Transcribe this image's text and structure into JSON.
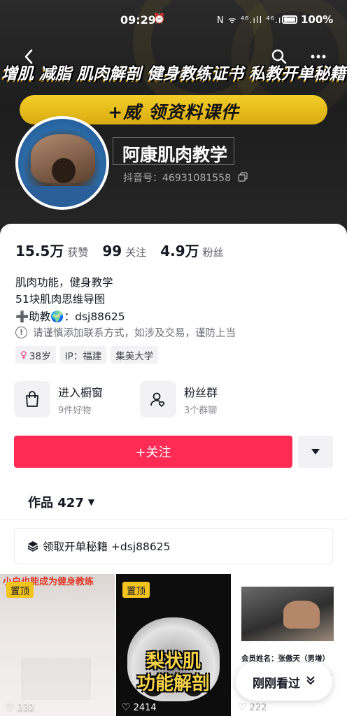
{
  "status_bar": {
    "time": "09:29",
    "alarm_icon": "alarm-icon",
    "system_icons": "N ᯤ ⁴⁶.ıll ⁴⁶.ıll",
    "battery_pct": "100%"
  },
  "nav": {
    "back_icon": "chevron-left-icon",
    "search_icon": "search-icon",
    "more_icon": "more-horizontal-icon"
  },
  "banner": {
    "headline": "增肌  减脂  肌肉解剖  健身教练证书  私教开单秘籍",
    "gold_button": "+威   领资料课件",
    "gold_color": "#eac21c"
  },
  "profile": {
    "name": "阿康肌肉教学",
    "douyin_id": "抖音号：46931081558"
  },
  "stats": [
    {
      "value": "15.5万",
      "label": "获赞"
    },
    {
      "value": "99",
      "label": "关注"
    },
    {
      "value": "4.9万",
      "label": "粉丝"
    }
  ],
  "bio": {
    "line1": "肌肉功能，健身教学",
    "line2": "51块肌肉思维导图",
    "line3": "➕助教🌍：dsj88625",
    "warning": "请谨慎添加联系方式，如涉及交易，谨防上当"
  },
  "tags": [
    {
      "icon": "female-icon",
      "text": "38岁"
    },
    {
      "text": "IP：福建"
    },
    {
      "text": "集美大学"
    }
  ],
  "services": [
    {
      "icon": "shopping-bag-icon",
      "title": "进入橱窗",
      "sub": "9件好物"
    },
    {
      "icon": "fans-group-icon",
      "title": "粉丝群",
      "sub": "3个群聊"
    }
  ],
  "actions": {
    "follow_label": "+关注",
    "follow_color": "#fe2c55",
    "dropdown_icon": "triangle-down-icon"
  },
  "works_tab": {
    "label": "作品 427"
  },
  "collection": {
    "label": "领取开单秘籍 +dsj88625",
    "icon": "stack-icon"
  },
  "videos": [
    {
      "pinned": "置顶",
      "caption": "小白也能成为健身教练",
      "likes": "232"
    },
    {
      "pinned": "置顶",
      "title_line1": "梨状肌",
      "title_line2": "功能解剖",
      "likes": "2414"
    },
    {
      "member_text": "会员姓名：张傲天（男增）",
      "likes": "222"
    }
  ],
  "floating": {
    "just_viewed": "刚刚看过"
  }
}
